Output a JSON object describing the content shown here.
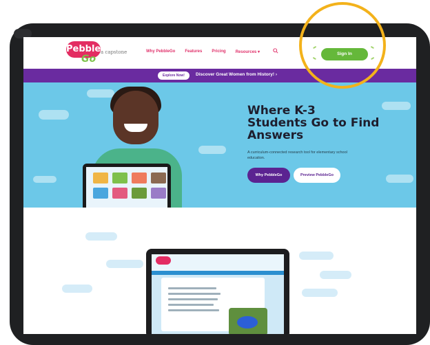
{
  "header": {
    "logo_text": "Pebble",
    "logo_sub": "Go",
    "partner": "a capstone",
    "nav": [
      "Why PebbleGo",
      "Features",
      "Pricing",
      "Resources ▾"
    ],
    "signin_label": "Sign In"
  },
  "banner": {
    "pill_label": "Explore Now!",
    "message": "Discover Great Women from History!  ›"
  },
  "hero": {
    "title_lines": [
      "Where K-3",
      "Students Go to Find",
      "Answers"
    ],
    "subtitle": "A curriculum-connected research tool for elementary school education.",
    "primary_button": "Why PebbleGo",
    "secondary_button": "Preview PebbleGo"
  },
  "colors": {
    "brand_pink": "#e32d62",
    "brand_green": "#65b83a",
    "brand_purple": "#6a2ba0",
    "hero_blue": "#6cc8e8",
    "highlight": "#f3b21b"
  },
  "icons": [
    "search-icon",
    "arrow-right-icon"
  ]
}
